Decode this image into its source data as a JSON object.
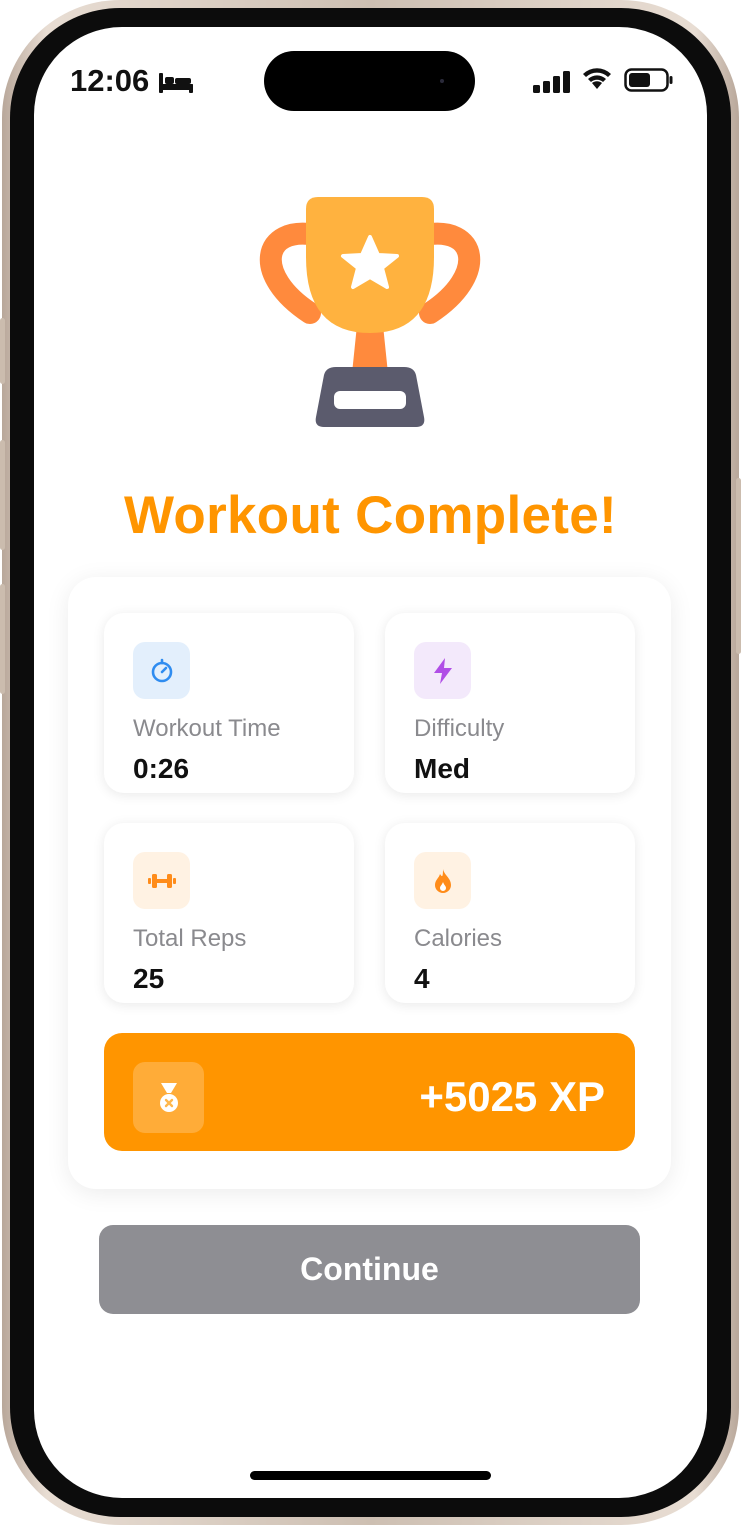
{
  "status_bar": {
    "time": "12:06",
    "focus_icon": "bed-icon",
    "signal_icon": "cellular-signal-icon",
    "wifi_icon": "wifi-icon",
    "battery_icon": "battery-icon"
  },
  "hero": {
    "icon": "trophy-icon",
    "title": "Workout Complete!"
  },
  "stats": [
    {
      "icon": "stopwatch-icon",
      "label": "Workout Time",
      "value": "0:26"
    },
    {
      "icon": "lightning-icon",
      "label": "Difficulty",
      "value": "Med"
    },
    {
      "icon": "dumbbell-icon",
      "label": "Total Reps",
      "value": "25"
    },
    {
      "icon": "flame-icon",
      "label": "Calories",
      "value": "4"
    }
  ],
  "xp": {
    "icon": "medal-icon",
    "value": "+5025 XP"
  },
  "continue_label": "Continue",
  "colors": {
    "accent": "#ff9500",
    "title": "#ff9500",
    "button_disabled": "#8e8e93",
    "stopwatch_bg": "#e3effc",
    "lightning_bg": "#f3e9fb",
    "dumbbell_bg": "#fff2e3",
    "flame_bg": "#fff2e3"
  }
}
